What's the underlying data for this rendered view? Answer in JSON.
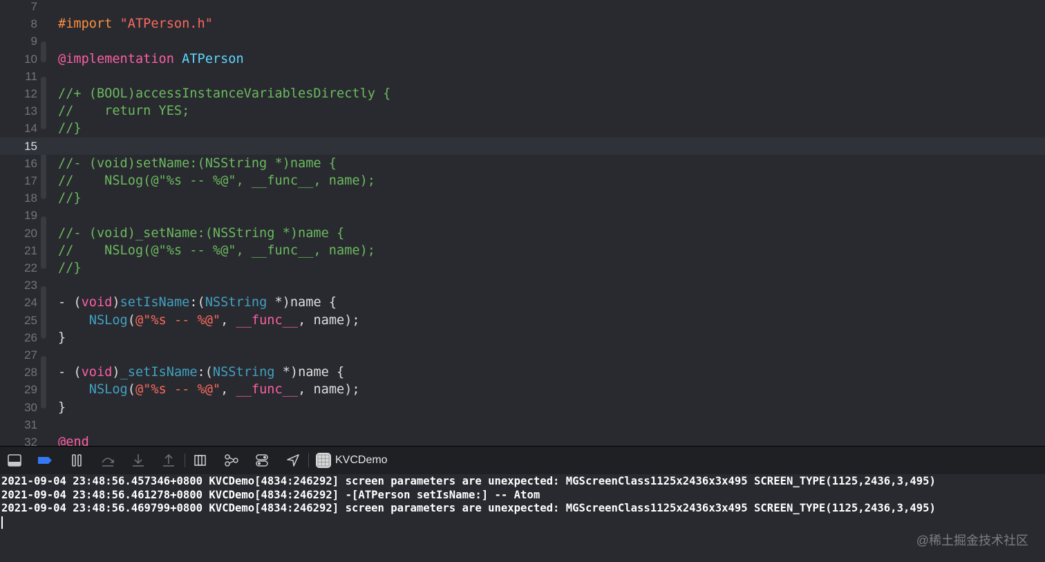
{
  "editor": {
    "first_line_number": 7,
    "current_line": 15,
    "lines": [
      {
        "n": "7",
        "segments": []
      },
      {
        "n": "8",
        "segments": [
          [
            "pre",
            "#import "
          ],
          [
            "str",
            "\"ATPerson.h\""
          ]
        ]
      },
      {
        "n": "9",
        "segments": []
      },
      {
        "n": "10",
        "segments": [
          [
            "kw",
            "@implementation"
          ],
          [
            "pln",
            " "
          ],
          [
            "cls",
            "ATPerson"
          ]
        ]
      },
      {
        "n": "11",
        "segments": []
      },
      {
        "n": "12",
        "segments": [
          [
            "com",
            "//+ (BOOL)accessInstanceVariablesDirectly {"
          ]
        ]
      },
      {
        "n": "13",
        "segments": [
          [
            "com",
            "//    return YES;"
          ]
        ]
      },
      {
        "n": "14",
        "segments": [
          [
            "com",
            "//}"
          ]
        ]
      },
      {
        "n": "15",
        "segments": []
      },
      {
        "n": "16",
        "segments": [
          [
            "com",
            "//- (void)setName:(NSString *)name {"
          ]
        ]
      },
      {
        "n": "17",
        "segments": [
          [
            "com",
            "//    NSLog(@\"%s -- %@\", __func__, name);"
          ]
        ]
      },
      {
        "n": "18",
        "segments": [
          [
            "com",
            "//}"
          ]
        ]
      },
      {
        "n": "19",
        "segments": []
      },
      {
        "n": "20",
        "segments": [
          [
            "com",
            "//- (void)_setName:(NSString *)name {"
          ]
        ]
      },
      {
        "n": "21",
        "segments": [
          [
            "com",
            "//    NSLog(@\"%s -- %@\", __func__, name);"
          ]
        ]
      },
      {
        "n": "22",
        "segments": [
          [
            "com",
            "//}"
          ]
        ]
      },
      {
        "n": "23",
        "segments": []
      },
      {
        "n": "24",
        "segments": [
          [
            "pln",
            "- ("
          ],
          [
            "kw",
            "void"
          ],
          [
            "pln",
            ")"
          ],
          [
            "typ",
            "setIsName"
          ],
          [
            "pln",
            ":("
          ],
          [
            "typ",
            "NSString"
          ],
          [
            "pln",
            " *)name {"
          ]
        ]
      },
      {
        "n": "25",
        "segments": [
          [
            "pln",
            "    "
          ],
          [
            "typ",
            "NSLog"
          ],
          [
            "pln",
            "("
          ],
          [
            "str",
            "@\"%s -- %@\""
          ],
          [
            "pln",
            ", "
          ],
          [
            "kw",
            "__func__"
          ],
          [
            "pln",
            ", name);"
          ]
        ]
      },
      {
        "n": "26",
        "segments": [
          [
            "pln",
            "}"
          ]
        ]
      },
      {
        "n": "27",
        "segments": []
      },
      {
        "n": "28",
        "segments": [
          [
            "pln",
            "- ("
          ],
          [
            "kw",
            "void"
          ],
          [
            "pln",
            ")"
          ],
          [
            "typ",
            "_setIsName"
          ],
          [
            "pln",
            ":("
          ],
          [
            "typ",
            "NSString"
          ],
          [
            "pln",
            " *)name {"
          ]
        ]
      },
      {
        "n": "29",
        "segments": [
          [
            "pln",
            "    "
          ],
          [
            "typ",
            "NSLog"
          ],
          [
            "pln",
            "("
          ],
          [
            "str",
            "@\"%s -- %@\""
          ],
          [
            "pln",
            ", "
          ],
          [
            "kw",
            "__func__"
          ],
          [
            "pln",
            ", name);"
          ]
        ]
      },
      {
        "n": "30",
        "segments": [
          [
            "pln",
            "}"
          ]
        ]
      },
      {
        "n": "31",
        "segments": []
      },
      {
        "n": "32",
        "segments": [
          [
            "kw",
            "@end"
          ]
        ]
      }
    ]
  },
  "debug_bar": {
    "buttons": [
      {
        "name": "hide-debug-area-icon"
      },
      {
        "name": "breakpoints-toggle-icon"
      },
      {
        "name": "pause-icon"
      },
      {
        "name": "step-over-icon"
      },
      {
        "name": "step-into-icon"
      },
      {
        "name": "step-out-icon"
      },
      {
        "name": "debug-view-hierarchy-icon"
      },
      {
        "name": "memory-graph-icon"
      },
      {
        "name": "environment-overrides-icon"
      },
      {
        "name": "simulate-location-icon"
      }
    ],
    "scheme_label": "KVCDemo"
  },
  "console": {
    "lines": [
      "2021-09-04 23:48:56.457346+0800 KVCDemo[4834:246292] screen parameters are unexpected: MGScreenClass1125x2436x3x495 SCREEN_TYPE(1125,2436,3,495)",
      "2021-09-04 23:48:56.461278+0800 KVCDemo[4834:246292] -[ATPerson setIsName:] -- Atom",
      "2021-09-04 23:48:56.469799+0800 KVCDemo[4834:246292] screen parameters are unexpected: MGScreenClass1125x2436x3x495 SCREEN_TYPE(1125,2436,3,495)"
    ],
    "watermark": "@稀土掘金技术社区"
  },
  "colors": {
    "background": "#292a30",
    "keyword": "#fc5fa3",
    "string": "#fc6a5d",
    "preprocessor": "#fd8f3f",
    "comment": "#6bba5e",
    "type": "#41a1c0",
    "class": "#5dd8ff",
    "plain": "#dfdfe0",
    "breakpoints_active": "#3478f6"
  }
}
